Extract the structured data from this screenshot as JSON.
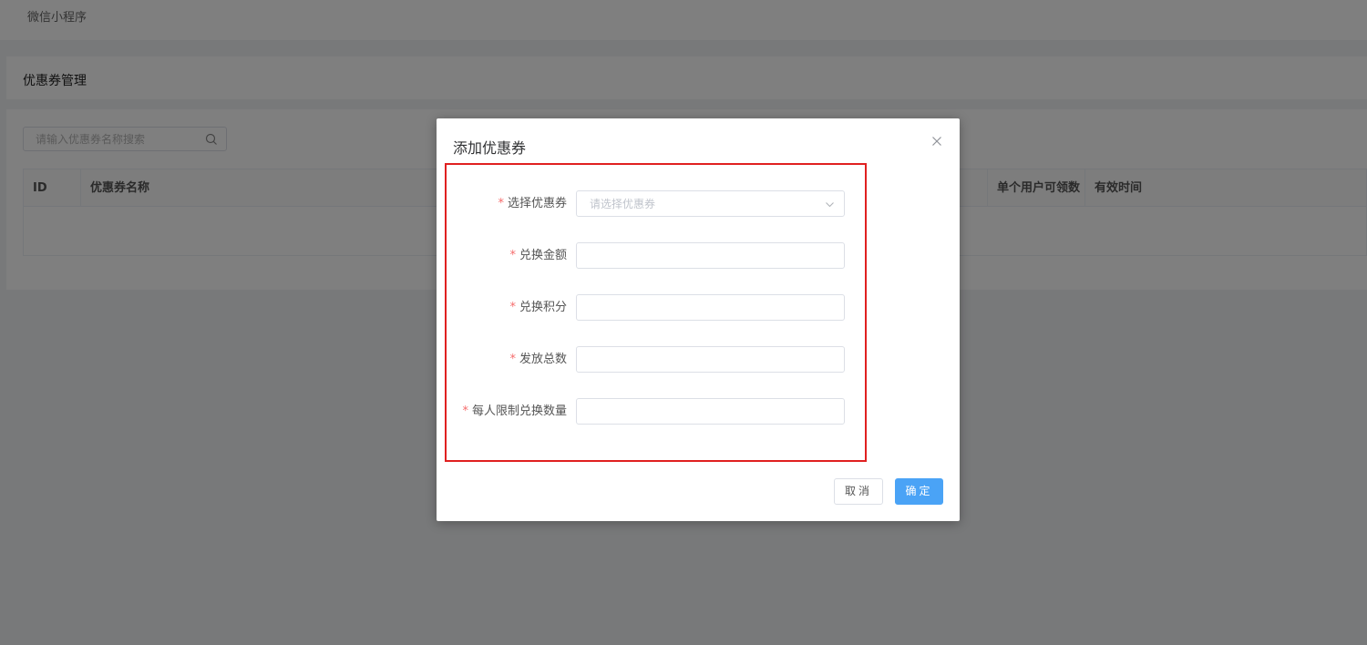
{
  "topbar": {
    "breadcrumb": "微信小程序"
  },
  "section": {
    "title": "优惠券管理"
  },
  "search": {
    "placeholder": "请输入优惠券名称搜索",
    "icon": "search-icon"
  },
  "table": {
    "columns": [
      "ID",
      "优惠券名称",
      "单个用户可领数",
      "有效时间"
    ],
    "rows": []
  },
  "dialog": {
    "title": "添加优惠券",
    "close_icon": "close-icon",
    "fields": [
      {
        "label": "选择优惠券",
        "required": true,
        "type": "select",
        "placeholder": "请选择优惠券",
        "value": ""
      },
      {
        "label": "兑换金额",
        "required": true,
        "type": "text",
        "value": ""
      },
      {
        "label": "兑换积分",
        "required": true,
        "type": "text",
        "value": ""
      },
      {
        "label": "发放总数",
        "required": true,
        "type": "text",
        "value": ""
      },
      {
        "label": "每人限制兑换数量",
        "required": true,
        "type": "text",
        "value": ""
      }
    ],
    "required_mark": "*",
    "cancel_label": "取消",
    "ok_label": "确定"
  },
  "colors": {
    "primary": "#4aa3f6",
    "required": "#f56c6c",
    "highlight": "#e02020",
    "mask": "rgba(0,0,0,0.5)"
  }
}
